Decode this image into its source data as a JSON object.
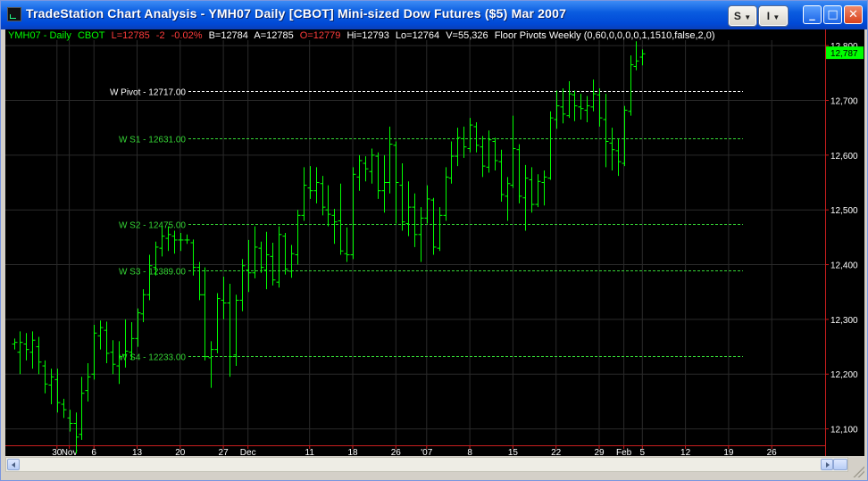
{
  "window": {
    "title": "TradeStation Chart Analysis - YMH07  Daily  [CBOT] Mini-sized Dow Futures ($5) Mar 2007",
    "s_button": "S",
    "i_button": "I",
    "minimize_glyph": "_",
    "maximize_glyph": "□",
    "close_glyph": "✕",
    "app_icon": "tradestation-chart-icon"
  },
  "status": {
    "symbol": "YMH07 - Daily",
    "exchange": "CBOT",
    "last": "L=12785",
    "change": "-2",
    "change_pct": "-0.02%",
    "bid": "B=12784",
    "ask": "A=12785",
    "open": "O=12779",
    "high": "Hi=12793",
    "low": "Lo=12764",
    "volume": "V=55,326",
    "indicator": "Floor Pivots Weekly (0,60,0,0,0,0,1,1510,false,2,0)"
  },
  "colors": {
    "background": "#000000",
    "bar": "#00ff00",
    "pivot": "#ffffff",
    "support": "#35d635",
    "axis_text": "#ffffff",
    "last_price_tag": "#00ff00",
    "negative": "#ff3c3c",
    "status_green": "#00ff00",
    "grid": "#2a2a2a"
  },
  "chart_data": {
    "type": "ohlc",
    "title": "YMH07 - Daily",
    "xlabel": "",
    "ylabel": "",
    "ylim": [
      12070,
      12810
    ],
    "y_ticks": [
      12100,
      12200,
      12300,
      12400,
      12500,
      12600,
      12700,
      12800
    ],
    "y_tick_labels": [
      "12,100",
      "12,200",
      "12,300",
      "12,400",
      "12,500",
      "12,600",
      "12,700",
      "12,800"
    ],
    "x_ticks": [
      {
        "label": "30",
        "bar": 7
      },
      {
        "label": "Nov",
        "bar": 9
      },
      {
        "label": "6",
        "bar": 13
      },
      {
        "label": "13",
        "bar": 20
      },
      {
        "label": "20",
        "bar": 27
      },
      {
        "label": "27",
        "bar": 34
      },
      {
        "label": "Dec",
        "bar": 38
      },
      {
        "label": "11",
        "bar": 48
      },
      {
        "label": "18",
        "bar": 55
      },
      {
        "label": "26",
        "bar": 62
      },
      {
        "label": "'07",
        "bar": 67
      },
      {
        "label": "8",
        "bar": 74
      },
      {
        "label": "15",
        "bar": 81
      },
      {
        "label": "22",
        "bar": 88
      },
      {
        "label": "29",
        "bar": 95
      },
      {
        "label": "Feb",
        "bar": 99
      },
      {
        "label": "5",
        "bar": 102
      },
      {
        "label": "12",
        "bar": 109
      },
      {
        "label": "19",
        "bar": 116
      },
      {
        "label": "26",
        "bar": 123
      }
    ],
    "last_price": 12787,
    "last_price_label": "12,787",
    "pivot_levels": [
      {
        "name": "W Pivot",
        "label": "W Pivot - 12717.00",
        "value": 12717,
        "kind": "pivot"
      },
      {
        "name": "W S1",
        "label": "W S1 - 12631.00",
        "value": 12631,
        "kind": "support"
      },
      {
        "name": "W S2",
        "label": "W S2 - 12475.00",
        "value": 12475,
        "kind": "support"
      },
      {
        "name": "W S3",
        "label": "W S3 - 12389.00",
        "value": 12389,
        "kind": "support"
      },
      {
        "name": "W S4",
        "label": "W S4 - 12233.00",
        "value": 12233,
        "kind": "support"
      }
    ],
    "bars": [
      {
        "o": 12255,
        "h": 12265,
        "l": 12245,
        "c": 12258
      },
      {
        "o": 12240,
        "h": 12278,
        "l": 12200,
        "c": 12258
      },
      {
        "o": 12255,
        "h": 12275,
        "l": 12225,
        "c": 12245
      },
      {
        "o": 12240,
        "h": 12278,
        "l": 12210,
        "c": 12262
      },
      {
        "o": 12250,
        "h": 12268,
        "l": 12200,
        "c": 12222
      },
      {
        "o": 12215,
        "h": 12225,
        "l": 12165,
        "c": 12182
      },
      {
        "o": 12180,
        "h": 12210,
        "l": 12145,
        "c": 12195
      },
      {
        "o": 12190,
        "h": 12210,
        "l": 12130,
        "c": 12148
      },
      {
        "o": 12145,
        "h": 12155,
        "l": 12120,
        "c": 12135
      },
      {
        "o": 12120,
        "h": 12135,
        "l": 12095,
        "c": 12110
      },
      {
        "o": 12110,
        "h": 12130,
        "l": 12055,
        "c": 12085
      },
      {
        "o": 12090,
        "h": 12195,
        "l": 12080,
        "c": 12165
      },
      {
        "o": 12170,
        "h": 12220,
        "l": 12150,
        "c": 12195
      },
      {
        "o": 12200,
        "h": 12290,
        "l": 12190,
        "c": 12275
      },
      {
        "o": 12270,
        "h": 12298,
        "l": 12245,
        "c": 12285
      },
      {
        "o": 12280,
        "h": 12296,
        "l": 12220,
        "c": 12238
      },
      {
        "o": 12240,
        "h": 12262,
        "l": 12200,
        "c": 12218
      },
      {
        "o": 12215,
        "h": 12260,
        "l": 12182,
        "c": 12232
      },
      {
        "o": 12235,
        "h": 12300,
        "l": 12212,
        "c": 12242
      },
      {
        "o": 12240,
        "h": 12295,
        "l": 12226,
        "c": 12265
      },
      {
        "o": 12265,
        "h": 12320,
        "l": 12250,
        "c": 12312
      },
      {
        "o": 12310,
        "h": 12355,
        "l": 12295,
        "c": 12345
      },
      {
        "o": 12345,
        "h": 12418,
        "l": 12335,
        "c": 12398
      },
      {
        "o": 12395,
        "h": 12442,
        "l": 12380,
        "c": 12432
      },
      {
        "o": 12430,
        "h": 12470,
        "l": 12415,
        "c": 12452
      },
      {
        "o": 12448,
        "h": 12470,
        "l": 12425,
        "c": 12455
      },
      {
        "o": 12452,
        "h": 12462,
        "l": 12420,
        "c": 12445
      },
      {
        "o": 12445,
        "h": 12458,
        "l": 12425,
        "c": 12445
      },
      {
        "o": 12445,
        "h": 12455,
        "l": 12438,
        "c": 12445
      },
      {
        "o": 12440,
        "h": 12446,
        "l": 12380,
        "c": 12395
      },
      {
        "o": 12395,
        "h": 12405,
        "l": 12335,
        "c": 12345
      },
      {
        "o": 12345,
        "h": 12395,
        "l": 12225,
        "c": 12232
      },
      {
        "o": 12230,
        "h": 12260,
        "l": 12175,
        "c": 12245
      },
      {
        "o": 12245,
        "h": 12348,
        "l": 12238,
        "c": 12338
      },
      {
        "o": 12335,
        "h": 12378,
        "l": 12300,
        "c": 12330
      },
      {
        "o": 12330,
        "h": 12365,
        "l": 12195,
        "c": 12232
      },
      {
        "o": 12235,
        "h": 12345,
        "l": 12215,
        "c": 12335
      },
      {
        "o": 12335,
        "h": 12410,
        "l": 12315,
        "c": 12398
      },
      {
        "o": 12390,
        "h": 12445,
        "l": 12350,
        "c": 12385
      },
      {
        "o": 12385,
        "h": 12470,
        "l": 12375,
        "c": 12432
      },
      {
        "o": 12430,
        "h": 12442,
        "l": 12385,
        "c": 12395
      },
      {
        "o": 12390,
        "h": 12460,
        "l": 12355,
        "c": 12418
      },
      {
        "o": 12415,
        "h": 12440,
        "l": 12362,
        "c": 12372
      },
      {
        "o": 12368,
        "h": 12470,
        "l": 12358,
        "c": 12455
      },
      {
        "o": 12452,
        "h": 12458,
        "l": 12382,
        "c": 12392
      },
      {
        "o": 12388,
        "h": 12436,
        "l": 12376,
        "c": 12420
      },
      {
        "o": 12418,
        "h": 12500,
        "l": 12400,
        "c": 12490
      },
      {
        "o": 12490,
        "h": 12578,
        "l": 12480,
        "c": 12545
      },
      {
        "o": 12540,
        "h": 12580,
        "l": 12520,
        "c": 12535
      },
      {
        "o": 12535,
        "h": 12578,
        "l": 12512,
        "c": 12550
      },
      {
        "o": 12548,
        "h": 12562,
        "l": 12490,
        "c": 12505
      },
      {
        "o": 12500,
        "h": 12545,
        "l": 12470,
        "c": 12492
      },
      {
        "o": 12490,
        "h": 12502,
        "l": 12438,
        "c": 12478
      },
      {
        "o": 12480,
        "h": 12548,
        "l": 12418,
        "c": 12425
      },
      {
        "o": 12420,
        "h": 12468,
        "l": 12405,
        "c": 12418
      },
      {
        "o": 12418,
        "h": 12578,
        "l": 12410,
        "c": 12565
      },
      {
        "o": 12560,
        "h": 12600,
        "l": 12535,
        "c": 12590
      },
      {
        "o": 12585,
        "h": 12598,
        "l": 12552,
        "c": 12575
      },
      {
        "o": 12570,
        "h": 12612,
        "l": 12548,
        "c": 12600
      },
      {
        "o": 12598,
        "h": 12605,
        "l": 12520,
        "c": 12535
      },
      {
        "o": 12535,
        "h": 12600,
        "l": 12495,
        "c": 12550
      },
      {
        "o": 12550,
        "h": 12652,
        "l": 12530,
        "c": 12620
      },
      {
        "o": 12618,
        "h": 12625,
        "l": 12475,
        "c": 12550
      },
      {
        "o": 12545,
        "h": 12585,
        "l": 12462,
        "c": 12478
      },
      {
        "o": 12475,
        "h": 12552,
        "l": 12452,
        "c": 12505
      },
      {
        "o": 12505,
        "h": 12530,
        "l": 12432,
        "c": 12455
      },
      {
        "o": 12455,
        "h": 12505,
        "l": 12405,
        "c": 12485
      },
      {
        "o": 12485,
        "h": 12545,
        "l": 12475,
        "c": 12520
      },
      {
        "o": 12518,
        "h": 12522,
        "l": 12418,
        "c": 12432
      },
      {
        "o": 12430,
        "h": 12505,
        "l": 12425,
        "c": 12490
      },
      {
        "o": 12490,
        "h": 12578,
        "l": 12480,
        "c": 12560
      },
      {
        "o": 12558,
        "h": 12625,
        "l": 12548,
        "c": 12598
      },
      {
        "o": 12598,
        "h": 12650,
        "l": 12580,
        "c": 12632
      },
      {
        "o": 12630,
        "h": 12652,
        "l": 12595,
        "c": 12615
      },
      {
        "o": 12612,
        "h": 12668,
        "l": 12605,
        "c": 12655
      },
      {
        "o": 12652,
        "h": 12660,
        "l": 12605,
        "c": 12618
      },
      {
        "o": 12615,
        "h": 12635,
        "l": 12560,
        "c": 12580
      },
      {
        "o": 12578,
        "h": 12645,
        "l": 12568,
        "c": 12628
      },
      {
        "o": 12625,
        "h": 12632,
        "l": 12572,
        "c": 12590
      },
      {
        "o": 12588,
        "h": 12610,
        "l": 12515,
        "c": 12528
      },
      {
        "o": 12525,
        "h": 12560,
        "l": 12480,
        "c": 12548
      },
      {
        "o": 12545,
        "h": 12672,
        "l": 12540,
        "c": 12612
      },
      {
        "o": 12610,
        "h": 12620,
        "l": 12512,
        "c": 12525
      },
      {
        "o": 12522,
        "h": 12582,
        "l": 12462,
        "c": 12558
      },
      {
        "o": 12555,
        "h": 12578,
        "l": 12495,
        "c": 12510
      },
      {
        "o": 12510,
        "h": 12565,
        "l": 12505,
        "c": 12552
      },
      {
        "o": 12550,
        "h": 12572,
        "l": 12508,
        "c": 12560
      },
      {
        "o": 12558,
        "h": 12680,
        "l": 12555,
        "c": 12668
      },
      {
        "o": 12665,
        "h": 12718,
        "l": 12648,
        "c": 12690
      },
      {
        "o": 12688,
        "h": 12722,
        "l": 12658,
        "c": 12675
      },
      {
        "o": 12672,
        "h": 12735,
        "l": 12668,
        "c": 12712
      },
      {
        "o": 12710,
        "h": 12718,
        "l": 12662,
        "c": 12690
      },
      {
        "o": 12688,
        "h": 12712,
        "l": 12665,
        "c": 12685
      },
      {
        "o": 12682,
        "h": 12708,
        "l": 12660,
        "c": 12690
      },
      {
        "o": 12688,
        "h": 12738,
        "l": 12680,
        "c": 12712
      },
      {
        "o": 12710,
        "h": 12722,
        "l": 12652,
        "c": 12668
      },
      {
        "o": 12665,
        "h": 12712,
        "l": 12578,
        "c": 12625
      },
      {
        "o": 12622,
        "h": 12650,
        "l": 12572,
        "c": 12610
      },
      {
        "o": 12608,
        "h": 12630,
        "l": 12562,
        "c": 12588
      },
      {
        "o": 12585,
        "h": 12690,
        "l": 12580,
        "c": 12682
      },
      {
        "o": 12680,
        "h": 12782,
        "l": 12672,
        "c": 12765
      },
      {
        "o": 12762,
        "h": 12808,
        "l": 12755,
        "c": 12772
      },
      {
        "o": 12779,
        "h": 12793,
        "l": 12764,
        "c": 12785
      }
    ]
  }
}
